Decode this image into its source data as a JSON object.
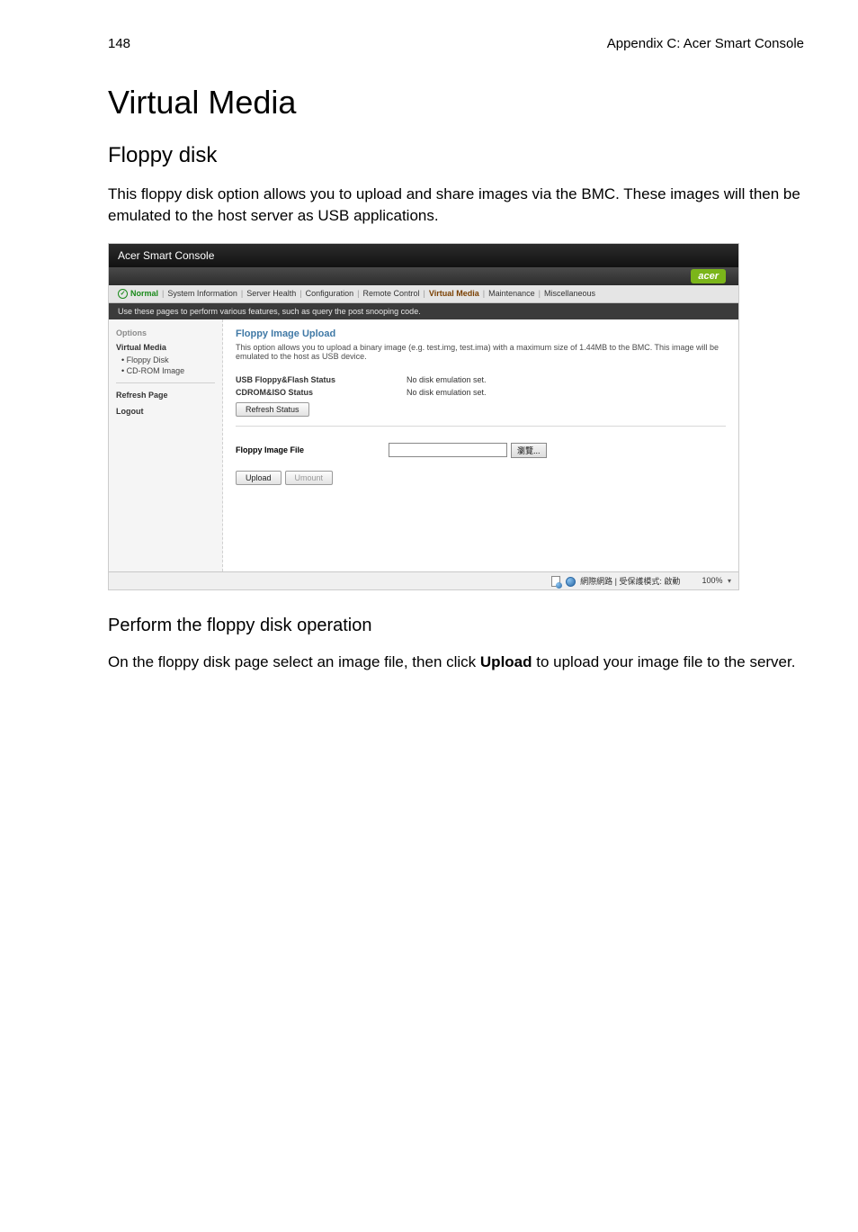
{
  "header": {
    "page_number": "148",
    "appendix": "Appendix C: Acer Smart Console"
  },
  "doc": {
    "h1": "Virtual Media",
    "h2": "Floppy disk",
    "intro": "This floppy disk option allows you to upload and share images via the BMC. These images will then be emulated to the host server as USB applications.",
    "h3": "Perform the floppy disk operation",
    "outro_pre": "On the floppy disk page select an image file, then click ",
    "outro_bold": "Upload",
    "outro_post": " to upload your image file to the server."
  },
  "shot": {
    "title": "Acer Smart Console",
    "brand": "acer",
    "nav": {
      "status": "Normal",
      "items": [
        "System Information",
        "Server Health",
        "Configuration",
        "Remote Control",
        "Virtual Media",
        "Maintenance",
        "Miscellaneous"
      ],
      "active_index": 4
    },
    "subbar": "Use these pages to perform various features, such as query the post snooping code.",
    "sidebar": {
      "title": "Options",
      "section": "Virtual Media",
      "items": [
        "Floppy Disk",
        "CD-ROM Image"
      ],
      "refresh": "Refresh Page",
      "logout": "Logout"
    },
    "panel": {
      "title": "Floppy Image Upload",
      "desc": "This option allows you to upload a binary image (e.g. test.img, test.ima) with a maximum size of 1.44MB to the BMC. This image will be emulated to the host as USB device.",
      "usb_label": "USB Floppy&Flash Status",
      "usb_value": "No disk emulation set.",
      "cdrom_label": "CDROM&ISO Status",
      "cdrom_value": "No disk emulation set.",
      "refresh_btn": "Refresh Status",
      "file_label": "Floppy Image File",
      "browse_btn": "瀏覽...",
      "upload_btn": "Upload",
      "umount_btn": "Umount"
    },
    "statusbar": {
      "net": "網際網路 | 受保護模式: 啟動",
      "zoom": "100%"
    }
  }
}
